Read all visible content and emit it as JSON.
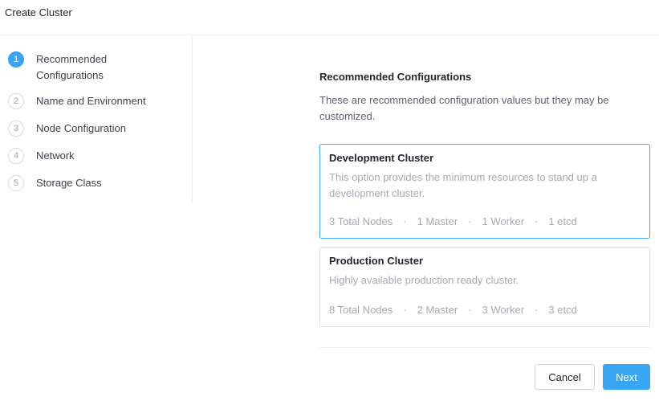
{
  "window": {
    "title": "Create Cluster"
  },
  "steps": [
    {
      "number": "1",
      "label": "Recommended Configurations",
      "active": true
    },
    {
      "number": "2",
      "label": "Name and Environment",
      "active": false
    },
    {
      "number": "3",
      "label": "Node Configuration",
      "active": false
    },
    {
      "number": "4",
      "label": "Network",
      "active": false
    },
    {
      "number": "5",
      "label": "Storage Class",
      "active": false
    }
  ],
  "main": {
    "title": "Recommended Configurations",
    "description": "These are recommended configuration values but they may be customized.",
    "cards": [
      {
        "title": "Development Cluster",
        "description": "This option provides the minimum resources to stand up a development cluster.",
        "specs": [
          "3 Total Nodes",
          "1 Master",
          "1 Worker",
          "1 etcd"
        ],
        "separator": "·",
        "selected": true
      },
      {
        "title": "Production Cluster",
        "description": "Highly available production ready cluster.",
        "specs": [
          "8 Total Nodes",
          "2 Master",
          "3 Worker",
          "3 etcd"
        ],
        "separator": "·",
        "selected": false
      }
    ]
  },
  "footer": {
    "cancel_label": "Cancel",
    "next_label": "Next"
  },
  "colors": {
    "accent": "#3aa5f4",
    "border": "#dcdfe4",
    "muted_text": "#a4aab3"
  }
}
